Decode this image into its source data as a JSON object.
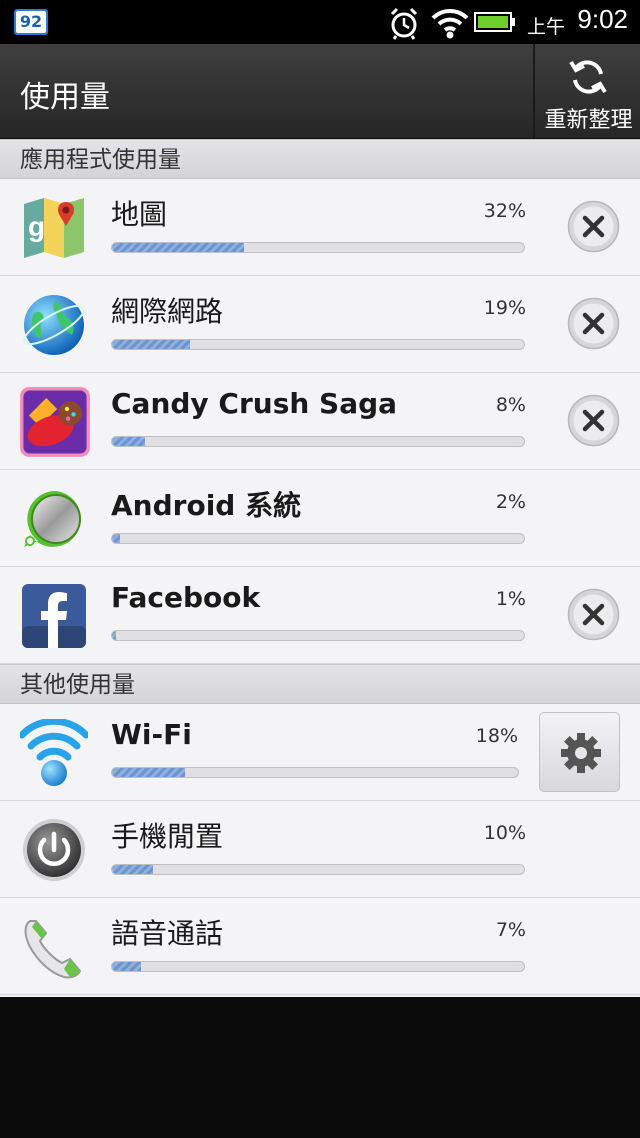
{
  "status_bar": {
    "notification_badge": "92",
    "ampm": "上午",
    "time": "9:02"
  },
  "action_bar": {
    "title": "使用量",
    "refresh_label": "重新整理"
  },
  "sections": [
    {
      "header": "應用程式使用量",
      "items": [
        {
          "name": "地圖",
          "percent": "32%",
          "value": 32,
          "icon": "maps-icon",
          "closable": true
        },
        {
          "name": "網際網路",
          "percent": "19%",
          "value": 19,
          "icon": "browser-globe-icon",
          "closable": true
        },
        {
          "name": "Candy Crush Saga",
          "percent": "8%",
          "value": 8,
          "icon": "candy-crush-icon",
          "closable": true
        },
        {
          "name": "Android 系統",
          "percent": "2%",
          "value": 2,
          "icon": "android-system-icon",
          "closable": false
        },
        {
          "name": "Facebook",
          "percent": "1%",
          "value": 1,
          "icon": "facebook-icon",
          "closable": true
        }
      ]
    },
    {
      "header": "其他使用量",
      "items": [
        {
          "name": "Wi-Fi",
          "percent": "18%",
          "value": 18,
          "icon": "wifi-icon",
          "settings": true
        },
        {
          "name": "手機閒置",
          "percent": "10%",
          "value": 10,
          "icon": "power-icon"
        },
        {
          "name": "語音通話",
          "percent": "7%",
          "value": 7,
          "icon": "phone-call-icon"
        }
      ]
    }
  ],
  "colors": {
    "bar_fill": "#7ea0d6",
    "accent_blue": "#2a7bd8"
  }
}
